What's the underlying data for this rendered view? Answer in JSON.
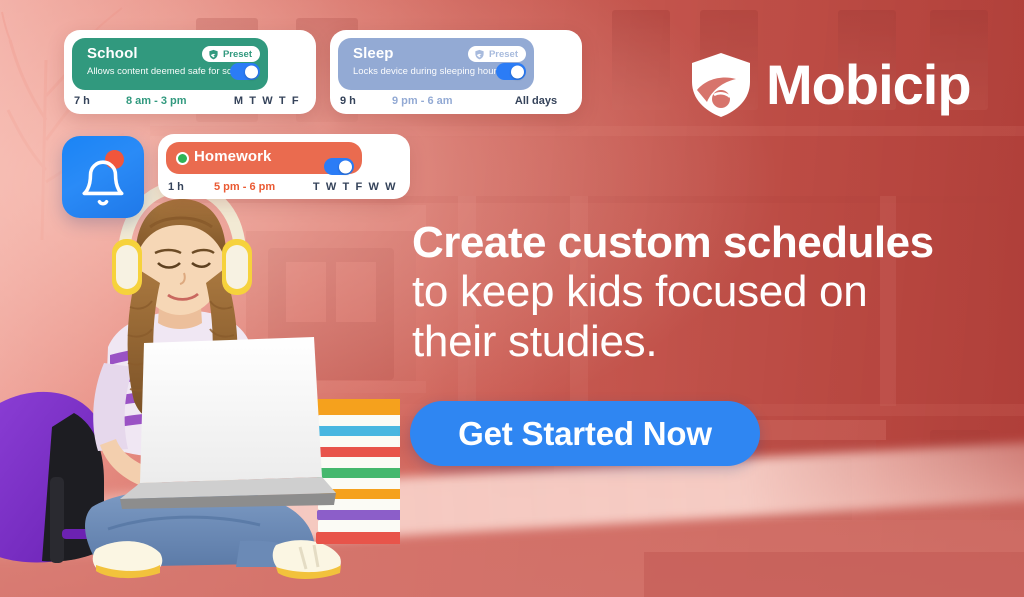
{
  "brand": {
    "name": "Mobicip",
    "logo_icon": "shield-swoosh-icon",
    "accent_blue": "#2f86f2",
    "background_red": "#d7746c"
  },
  "headline": {
    "line1": "Create custom schedules",
    "line2": "to keep kids focused on",
    "line3": "their studies."
  },
  "cta": {
    "label": "Get Started Now",
    "color": "#2f86f2"
  },
  "bell_tile": {
    "icon": "bell-icon",
    "badge_icon": "notification-badge-icon",
    "tile_color": "#1f80f0",
    "badge_color": "#f0563c"
  },
  "schedules": [
    {
      "id": "school",
      "title": "School",
      "subtitle": "Allows content deemed safe for school",
      "preset_label": "Preset",
      "preset_icon": "shield-icon",
      "duration": "7 h",
      "time_range": "8 am - 3 pm",
      "days": "M T W T F",
      "toggle_state": "on",
      "color": "#31997e"
    },
    {
      "id": "sleep",
      "title": "Sleep",
      "subtitle": "Locks device during sleeping hours",
      "preset_label": "Preset",
      "preset_icon": "shield-icon",
      "duration": "9 h",
      "time_range": "9 pm - 6 am",
      "days": "All days",
      "toggle_state": "on",
      "color": "#93aad4"
    },
    {
      "id": "homework",
      "title": "Homework",
      "status_dot": "active-dot-icon",
      "duration": "1 h",
      "time_range": "5 pm - 6 pm",
      "days": "T W T F W W",
      "toggle_state": "on",
      "color": "#ea6b4f"
    }
  ],
  "photo": {
    "description": "girl-with-laptop-photo",
    "elements": [
      "headphones",
      "braids",
      "striped-shirt",
      "laptop",
      "backpack",
      "book-stack",
      "sneakers"
    ]
  }
}
